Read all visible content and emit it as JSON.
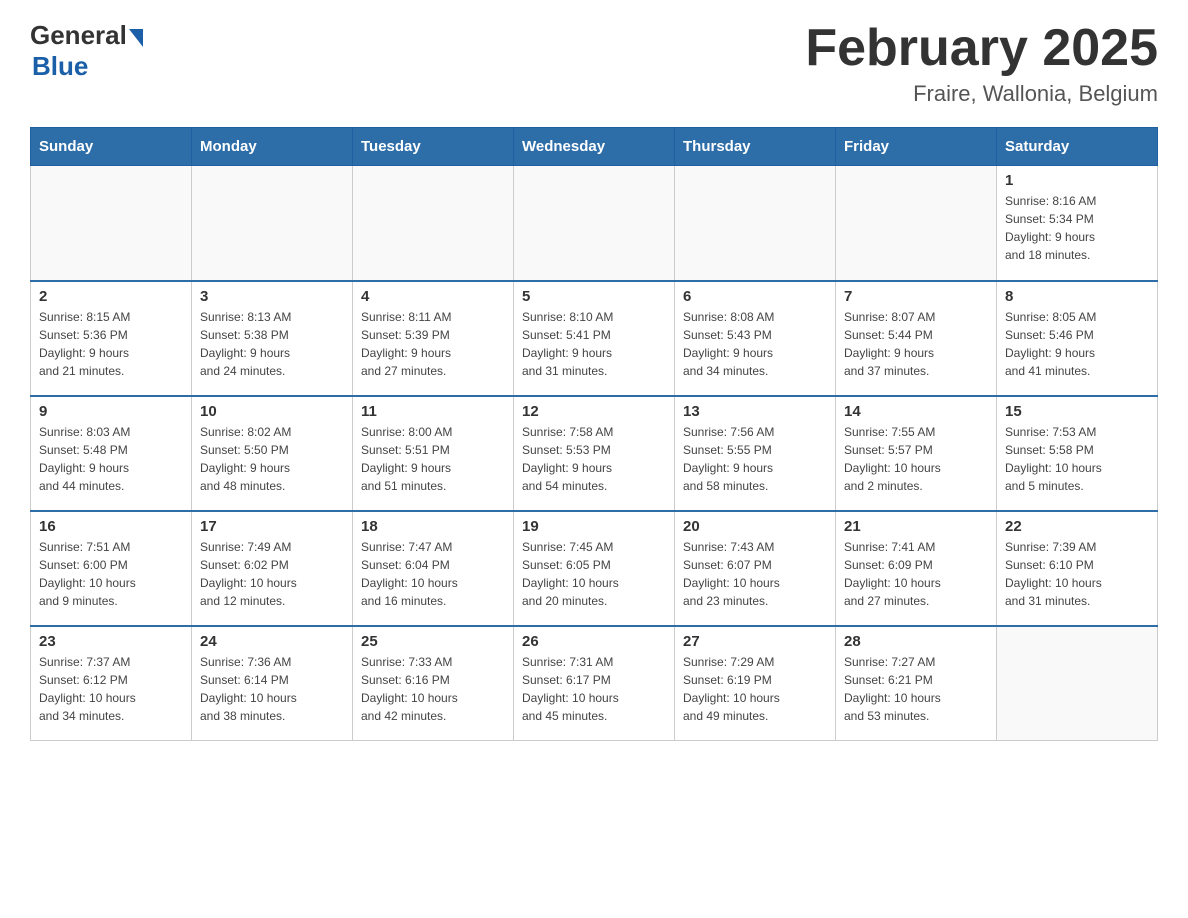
{
  "header": {
    "logo": {
      "general": "General",
      "blue": "Blue"
    },
    "title": "February 2025",
    "subtitle": "Fraire, Wallonia, Belgium"
  },
  "weekdays": [
    "Sunday",
    "Monday",
    "Tuesday",
    "Wednesday",
    "Thursday",
    "Friday",
    "Saturday"
  ],
  "weeks": [
    [
      {
        "day": "",
        "info": ""
      },
      {
        "day": "",
        "info": ""
      },
      {
        "day": "",
        "info": ""
      },
      {
        "day": "",
        "info": ""
      },
      {
        "day": "",
        "info": ""
      },
      {
        "day": "",
        "info": ""
      },
      {
        "day": "1",
        "info": "Sunrise: 8:16 AM\nSunset: 5:34 PM\nDaylight: 9 hours\nand 18 minutes."
      }
    ],
    [
      {
        "day": "2",
        "info": "Sunrise: 8:15 AM\nSunset: 5:36 PM\nDaylight: 9 hours\nand 21 minutes."
      },
      {
        "day": "3",
        "info": "Sunrise: 8:13 AM\nSunset: 5:38 PM\nDaylight: 9 hours\nand 24 minutes."
      },
      {
        "day": "4",
        "info": "Sunrise: 8:11 AM\nSunset: 5:39 PM\nDaylight: 9 hours\nand 27 minutes."
      },
      {
        "day": "5",
        "info": "Sunrise: 8:10 AM\nSunset: 5:41 PM\nDaylight: 9 hours\nand 31 minutes."
      },
      {
        "day": "6",
        "info": "Sunrise: 8:08 AM\nSunset: 5:43 PM\nDaylight: 9 hours\nand 34 minutes."
      },
      {
        "day": "7",
        "info": "Sunrise: 8:07 AM\nSunset: 5:44 PM\nDaylight: 9 hours\nand 37 minutes."
      },
      {
        "day": "8",
        "info": "Sunrise: 8:05 AM\nSunset: 5:46 PM\nDaylight: 9 hours\nand 41 minutes."
      }
    ],
    [
      {
        "day": "9",
        "info": "Sunrise: 8:03 AM\nSunset: 5:48 PM\nDaylight: 9 hours\nand 44 minutes."
      },
      {
        "day": "10",
        "info": "Sunrise: 8:02 AM\nSunset: 5:50 PM\nDaylight: 9 hours\nand 48 minutes."
      },
      {
        "day": "11",
        "info": "Sunrise: 8:00 AM\nSunset: 5:51 PM\nDaylight: 9 hours\nand 51 minutes."
      },
      {
        "day": "12",
        "info": "Sunrise: 7:58 AM\nSunset: 5:53 PM\nDaylight: 9 hours\nand 54 minutes."
      },
      {
        "day": "13",
        "info": "Sunrise: 7:56 AM\nSunset: 5:55 PM\nDaylight: 9 hours\nand 58 minutes."
      },
      {
        "day": "14",
        "info": "Sunrise: 7:55 AM\nSunset: 5:57 PM\nDaylight: 10 hours\nand 2 minutes."
      },
      {
        "day": "15",
        "info": "Sunrise: 7:53 AM\nSunset: 5:58 PM\nDaylight: 10 hours\nand 5 minutes."
      }
    ],
    [
      {
        "day": "16",
        "info": "Sunrise: 7:51 AM\nSunset: 6:00 PM\nDaylight: 10 hours\nand 9 minutes."
      },
      {
        "day": "17",
        "info": "Sunrise: 7:49 AM\nSunset: 6:02 PM\nDaylight: 10 hours\nand 12 minutes."
      },
      {
        "day": "18",
        "info": "Sunrise: 7:47 AM\nSunset: 6:04 PM\nDaylight: 10 hours\nand 16 minutes."
      },
      {
        "day": "19",
        "info": "Sunrise: 7:45 AM\nSunset: 6:05 PM\nDaylight: 10 hours\nand 20 minutes."
      },
      {
        "day": "20",
        "info": "Sunrise: 7:43 AM\nSunset: 6:07 PM\nDaylight: 10 hours\nand 23 minutes."
      },
      {
        "day": "21",
        "info": "Sunrise: 7:41 AM\nSunset: 6:09 PM\nDaylight: 10 hours\nand 27 minutes."
      },
      {
        "day": "22",
        "info": "Sunrise: 7:39 AM\nSunset: 6:10 PM\nDaylight: 10 hours\nand 31 minutes."
      }
    ],
    [
      {
        "day": "23",
        "info": "Sunrise: 7:37 AM\nSunset: 6:12 PM\nDaylight: 10 hours\nand 34 minutes."
      },
      {
        "day": "24",
        "info": "Sunrise: 7:36 AM\nSunset: 6:14 PM\nDaylight: 10 hours\nand 38 minutes."
      },
      {
        "day": "25",
        "info": "Sunrise: 7:33 AM\nSunset: 6:16 PM\nDaylight: 10 hours\nand 42 minutes."
      },
      {
        "day": "26",
        "info": "Sunrise: 7:31 AM\nSunset: 6:17 PM\nDaylight: 10 hours\nand 45 minutes."
      },
      {
        "day": "27",
        "info": "Sunrise: 7:29 AM\nSunset: 6:19 PM\nDaylight: 10 hours\nand 49 minutes."
      },
      {
        "day": "28",
        "info": "Sunrise: 7:27 AM\nSunset: 6:21 PM\nDaylight: 10 hours\nand 53 minutes."
      },
      {
        "day": "",
        "info": ""
      }
    ]
  ]
}
